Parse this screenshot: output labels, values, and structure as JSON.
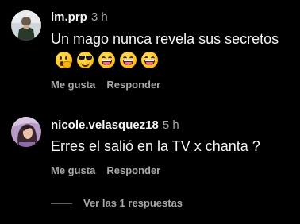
{
  "comments": [
    {
      "username": "lm.prp",
      "time": "3 h",
      "text": "Un mago nunca revela sus secretos",
      "emojis": [
        "shushing-face",
        "smiling-face-with-sunglasses",
        "grinning-squinting-face",
        "grinning-squinting-face",
        "grinning-squinting-face"
      ],
      "like_label": "Me gusta",
      "reply_label": "Responder"
    },
    {
      "username": "nicole.velasquez18",
      "time": "5 h",
      "text": "Erres el salió en la TV x chanta ?",
      "like_label": "Me gusta",
      "reply_label": "Responder",
      "view_replies_label": "Ver las 1 respuestas"
    }
  ],
  "colors": {
    "background": "#000000",
    "primary_text": "#f5f5f5",
    "secondary_text": "#a8a8a8"
  }
}
